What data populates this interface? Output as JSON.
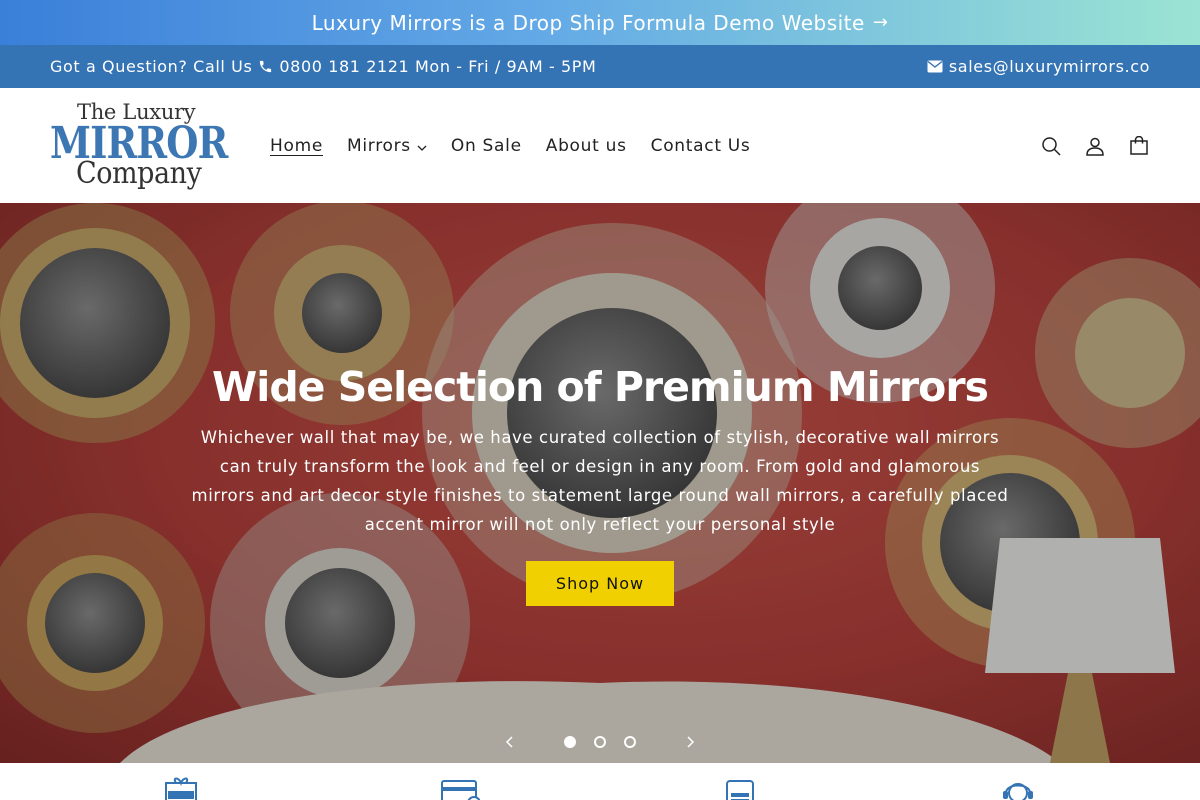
{
  "announcement": {
    "text": "Luxury Mirrors is a Drop Ship Formula Demo Website",
    "arrow": "→"
  },
  "contact_bar": {
    "question": "Got a Question? Call Us",
    "phone": "0800 181 2121 Mon - Fri / 9AM - 5PM",
    "email": "sales@luxurymirrors.co"
  },
  "logo": {
    "line1": "The Luxury",
    "line2": "MIRROR",
    "line3": "Company"
  },
  "nav": {
    "items": [
      {
        "label": "Home"
      },
      {
        "label": "Mirrors"
      },
      {
        "label": "On Sale"
      },
      {
        "label": "About us"
      },
      {
        "label": "Contact Us"
      }
    ]
  },
  "header_icons": [
    "search-icon",
    "account-icon",
    "cart-icon"
  ],
  "hero": {
    "title": "Wide Selection of Premium Mirrors",
    "text": "Whichever wall that may be, we have curated collection of stylish, decorative wall mirrors can truly transform the look and feel or design in any room. From gold and glamorous mirrors and art decor style finishes to statement large round wall mirrors, a carefully placed accent mirror will not only reflect your personal style",
    "button": "Shop Now",
    "slides": 3,
    "active_slide": 1
  },
  "features": {
    "icons": [
      "free-shipping-icon",
      "payment-card-icon",
      "low-price-icon",
      "support-agent-icon"
    ]
  },
  "colors": {
    "contact_bar": "#3473b4",
    "button": "#f0d000",
    "logo_blue": "#3d77b3"
  }
}
